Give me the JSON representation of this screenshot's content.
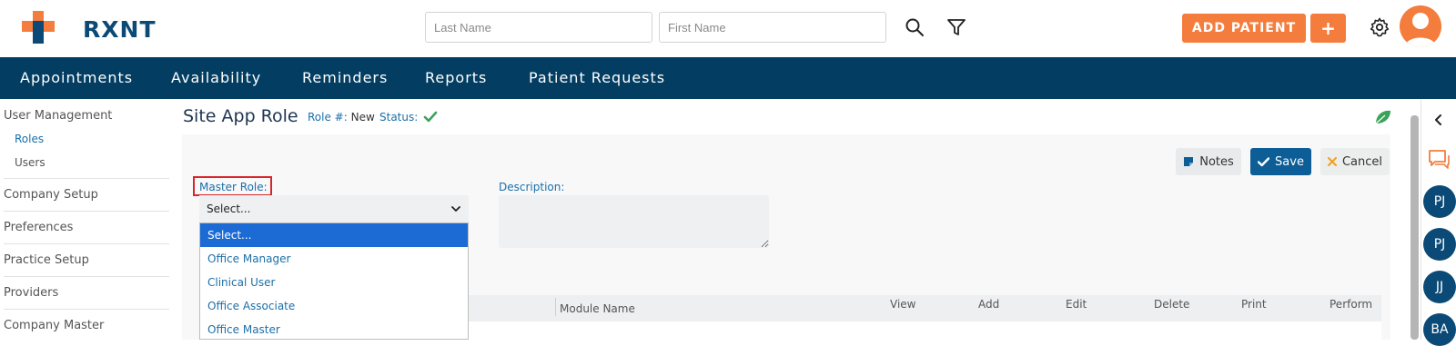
{
  "header": {
    "logo_text": "RXNT",
    "last_name_placeholder": "Last Name",
    "first_name_placeholder": "First Name",
    "add_patient_label": "ADD PATIENT",
    "add_plus_label": "+"
  },
  "nav": {
    "items": [
      "Appointments",
      "Availability",
      "Reminders",
      "Reports",
      "Patient Requests"
    ]
  },
  "sidebar": {
    "user_management": "User Management",
    "roles": "Roles",
    "users": "Users",
    "company_setup": "Company Setup",
    "preferences": "Preferences",
    "practice_setup": "Practice Setup",
    "providers": "Providers",
    "company_master": "Company Master"
  },
  "page": {
    "title": "Site App Role",
    "role_label": "Role #:",
    "role_value": "New",
    "status_label": "Status:"
  },
  "buttons": {
    "notes": "Notes",
    "save": "Save",
    "cancel": "Cancel"
  },
  "form": {
    "master_role_label": "Master Role:",
    "master_role_value": "Select...",
    "description_label": "Description:",
    "options": [
      "Select...",
      "Office Manager",
      "Clinical User",
      "Office Associate",
      "Office Master"
    ]
  },
  "table": {
    "headers": [
      "Module Name",
      "View",
      "Add",
      "Edit",
      "Delete",
      "Print",
      "Perform"
    ]
  },
  "rail": {
    "bubbles": [
      "PJ",
      "PJ",
      "JJ",
      "BA"
    ]
  },
  "colors": {
    "brand_navy": "#033d62",
    "accent_orange": "#f47c3c",
    "link_blue": "#1b6fa8",
    "status_green": "#3aa35a"
  }
}
